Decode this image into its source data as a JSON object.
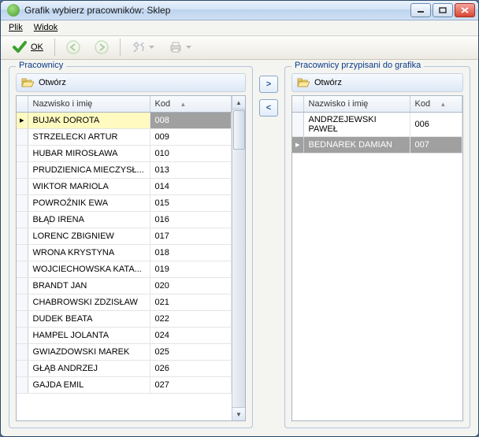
{
  "window": {
    "title": "Grafik wybierz pracowników: Sklep"
  },
  "menu": {
    "plik": "Plik",
    "widok": "Widok"
  },
  "toolbar": {
    "ok": "OK"
  },
  "leftPanel": {
    "legend": "Pracownicy",
    "open": "Otwórz",
    "colName": "Nazwisko i imię",
    "colCode": "Kod",
    "sortIndicator": "▴",
    "rows": [
      {
        "name": "BUJAK DOROTA",
        "code": "008",
        "selected": true
      },
      {
        "name": "STRZELECKI ARTUR",
        "code": "009"
      },
      {
        "name": "HUBAR MIROSŁAWA",
        "code": "010"
      },
      {
        "name": "PRUDZIENICA MIECZYSŁ...",
        "code": "013"
      },
      {
        "name": "WIKTOR MARIOLA",
        "code": "014"
      },
      {
        "name": "POWROŹNIK EWA",
        "code": "015"
      },
      {
        "name": "BŁĄD IRENA",
        "code": "016"
      },
      {
        "name": "LORENC ZBIGNIEW",
        "code": "017"
      },
      {
        "name": "WRONA KRYSTYNA",
        "code": "018"
      },
      {
        "name": "WOJCIECHOWSKA KATA...",
        "code": "019"
      },
      {
        "name": "BRANDT JAN",
        "code": "020"
      },
      {
        "name": "CHABROWSKI ZDZISŁAW",
        "code": "021"
      },
      {
        "name": "DUDEK BEATA",
        "code": "022"
      },
      {
        "name": "HAMPEL JOLANTA",
        "code": "024"
      },
      {
        "name": "GWIAZDOWSKI MAREK",
        "code": "025"
      },
      {
        "name": "GŁĄB ANDRZEJ",
        "code": "026"
      },
      {
        "name": "GAJDA EMIL",
        "code": "027"
      }
    ]
  },
  "rightPanel": {
    "legend": "Pracownicy przypisani do grafika",
    "open": "Otwórz",
    "colName": "Nazwisko i imię",
    "colCode": "Kod",
    "rows": [
      {
        "name": "ANDRZEJEWSKI PAWEŁ",
        "code": "006"
      },
      {
        "name": "BEDNAREK DAMIAN",
        "code": "007",
        "selected": true
      }
    ]
  },
  "transfer": {
    "right": ">",
    "left": "<"
  }
}
